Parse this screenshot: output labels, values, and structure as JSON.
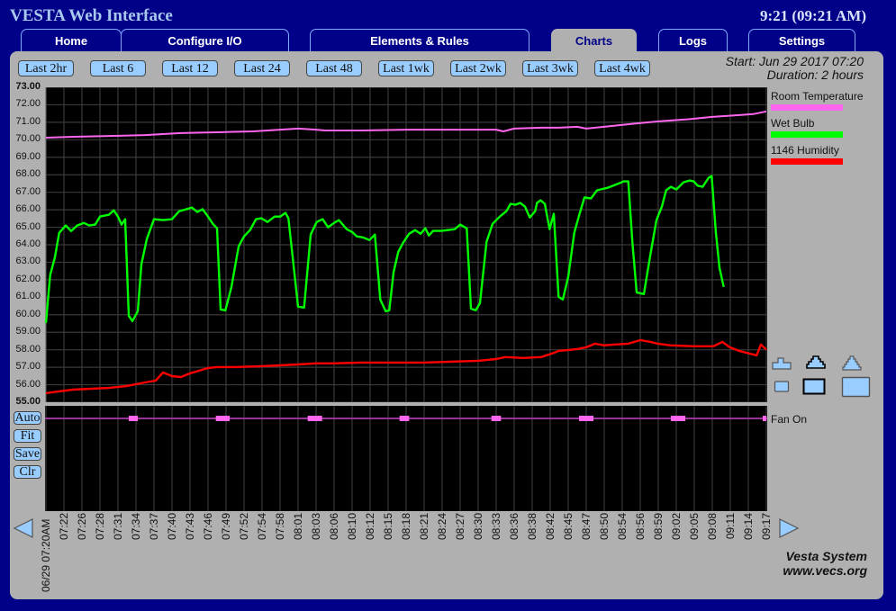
{
  "header": {
    "title": "VESTA Web Interface",
    "clock": "9:21 (09:21 AM)"
  },
  "tabs": [
    {
      "label": "Home",
      "active": false
    },
    {
      "label": "Configure I/O",
      "active": false
    },
    {
      "label": "Elements & Rules",
      "active": false
    },
    {
      "label": "Charts",
      "active": true
    },
    {
      "label": "Logs",
      "active": false
    },
    {
      "label": "Settings",
      "active": false
    }
  ],
  "range_buttons": [
    "Last 2hr",
    "Last 6",
    "Last 12",
    "Last 24",
    "Last 48",
    "Last 1wk",
    "Last 2wk",
    "Last 3wk",
    "Last 4wk"
  ],
  "info": {
    "start": "Start: Jun 29 2017 07:20",
    "duration": "Duration: 2 hours"
  },
  "side_buttons": [
    "Auto",
    "Fit",
    "Save",
    "Clr"
  ],
  "footer": {
    "line1": "Vesta System",
    "line2": "www.vecs.org"
  },
  "nav": {
    "prev": "previous-period",
    "next": "next-period"
  },
  "zoom_controls": [
    "zoom-in-small",
    "zoom-in-medium-selected",
    "zoom-in-large",
    "size-small",
    "size-medium-selected",
    "size-large"
  ],
  "colors": {
    "background": "#000088",
    "panel": "#b0b0b0",
    "button": "#99ccff",
    "room_temp": "#ff66ee",
    "wet_bulb": "#00ff00",
    "humidity": "#ff0000",
    "fan_on": "#ff66ee",
    "fan_line": "#993399"
  },
  "chart_data": [
    {
      "type": "line",
      "title": "",
      "ylim": [
        55,
        73
      ],
      "yticks": [
        "73.00",
        "72.00",
        "71.00",
        "70.00",
        "69.00",
        "68.00",
        "67.00",
        "66.00",
        "65.00",
        "64.00",
        "63.00",
        "62.00",
        "61.00",
        "60.00",
        "59.00",
        "58.00",
        "57.00",
        "56.00",
        "55.00"
      ],
      "xlim_minutes": [
        0,
        120
      ],
      "xticks": [
        "06/29 07:20AM",
        "07:22",
        "07:26",
        "07:28",
        "07:31",
        "07:34",
        "07:37",
        "07:40",
        "07:43",
        "07:46",
        "07:49",
        "07:52",
        "07:54",
        "07:58",
        "08:01",
        "08:03",
        "08:06",
        "08:10",
        "08:12",
        "08:15",
        "08:18",
        "08:21",
        "08:24",
        "08:27",
        "08:30",
        "08:33",
        "08:36",
        "08:38",
        "08:42",
        "08:45",
        "08:47",
        "08:50",
        "08:54",
        "08:56",
        "08:59",
        "09:02",
        "09:05",
        "09:08",
        "09:11",
        "09:14",
        "09:17"
      ],
      "grid": true,
      "legend_position": "right",
      "series": [
        {
          "name": "Room Temperature",
          "color": "#ff66ee",
          "x": [
            0,
            4.5,
            10.5,
            16.5,
            22.5,
            28.5,
            34.5,
            39,
            42,
            45,
            46.5,
            52.5,
            60,
            67.5,
            75,
            76.2,
            78,
            82.5,
            85.5,
            88.5,
            90,
            93,
            97.5,
            102,
            106.5,
            111,
            115.5,
            117.8,
            119.3,
            120
          ],
          "y": [
            70.12,
            70.17,
            70.22,
            70.27,
            70.38,
            70.43,
            70.48,
            70.58,
            70.64,
            70.58,
            70.53,
            70.53,
            70.58,
            70.58,
            70.58,
            70.48,
            70.64,
            70.69,
            70.69,
            70.74,
            70.64,
            70.74,
            70.9,
            71.05,
            71.16,
            71.31,
            71.41,
            71.47,
            71.57,
            71.62
          ]
        },
        {
          "name": "Wet Bulb",
          "color": "#00ff00",
          "x": [
            0,
            0.7,
            1.5,
            2.2,
            3.3,
            4.2,
            5.2,
            6.3,
            7.2,
            8.2,
            9,
            10.5,
            11.3,
            12,
            12.6,
            13.2,
            13.8,
            14.4,
            15.3,
            15.9,
            16.8,
            18,
            19.5,
            21,
            22.2,
            23.4,
            24.3,
            25.2,
            26.1,
            27,
            27.8,
            28.5,
            29.1,
            29.9,
            30.9,
            32.1,
            33,
            34,
            35,
            35.9,
            36.9,
            38.1,
            39,
            39.9,
            40.4,
            42,
            43,
            44.1,
            45.1,
            46.1,
            47,
            48,
            48.8,
            50.1,
            51,
            51.8,
            52.8,
            53.9,
            54.8,
            55.7,
            56.6,
            57.2,
            57.9,
            58.7,
            59.5,
            60.5,
            61.5,
            62.4,
            63.2,
            63.8,
            64.5,
            65.9,
            68.1,
            69,
            70.1,
            70.8,
            71.6,
            72.3,
            73.4,
            74.4,
            75.6,
            76.7,
            77.4,
            78.2,
            79,
            79.8,
            80.6,
            81.5,
            81.8,
            82.4,
            83.1,
            83.9,
            84.6,
            85.4,
            86.1,
            87,
            88,
            88.8,
            89.7,
            90.8,
            91.8,
            93.6,
            94.8,
            95.9,
            96.2,
            97,
            97.7,
            98.4,
            99.6,
            100.7,
            101.7,
            102.6,
            103.3,
            104.1,
            105,
            106.2,
            107.2,
            107.9,
            108.6,
            109.4,
            110.4,
            110.9,
            111.6,
            112.2,
            112.9
          ],
          "y": [
            59.53,
            62.26,
            63.29,
            64.68,
            65.1,
            64.78,
            65.1,
            65.25,
            65.1,
            65.15,
            65.61,
            65.72,
            65.97,
            65.61,
            65.15,
            65.46,
            59.94,
            59.64,
            60.2,
            62.88,
            64.32,
            65.46,
            65.41,
            65.46,
            65.92,
            66.03,
            66.13,
            65.87,
            66.03,
            65.61,
            65.2,
            64.94,
            60.3,
            60.25,
            61.59,
            63.91,
            64.48,
            64.84,
            65.46,
            65.51,
            65.3,
            65.61,
            65.61,
            65.82,
            65.51,
            60.46,
            60.41,
            64.58,
            65.3,
            65.46,
            65.0,
            65.25,
            65.41,
            64.89,
            64.73,
            64.48,
            64.42,
            64.27,
            64.58,
            60.87,
            60.2,
            60.25,
            62.42,
            63.6,
            64.12,
            64.63,
            64.84,
            64.63,
            64.94,
            64.53,
            64.79,
            64.79,
            64.89,
            65.15,
            64.94,
            60.35,
            60.25,
            60.66,
            64.17,
            65.2,
            65.61,
            65.92,
            66.34,
            66.29,
            66.39,
            66.18,
            65.56,
            65.92,
            66.39,
            66.54,
            66.34,
            64.89,
            65.77,
            61.02,
            60.87,
            62.16,
            64.68,
            65.66,
            66.7,
            66.65,
            67.11,
            67.26,
            67.42,
            67.57,
            67.62,
            67.62,
            64.12,
            61.28,
            61.18,
            63.45,
            65.41,
            66.18,
            67.11,
            67.31,
            67.16,
            67.57,
            67.67,
            67.62,
            67.37,
            67.31,
            67.83,
            67.93,
            64.68,
            62.68,
            61.59
          ]
        },
        {
          "name": "1146 Humidity",
          "color": "#ff0000",
          "x": [
            0,
            2.2,
            4.5,
            7.5,
            10.5,
            13.5,
            16.5,
            18.3,
            19.5,
            21,
            22.5,
            24,
            25.5,
            27,
            28.5,
            31.5,
            36,
            39,
            42,
            45,
            48,
            52.5,
            57,
            63,
            67.5,
            72,
            75,
            76.5,
            79.5,
            82.5,
            84.3,
            85.5,
            87,
            88.5,
            90,
            91.5,
            93,
            94.8,
            97,
            99,
            100.7,
            101.9,
            104.1,
            107.9,
            111.2,
            112.7,
            113.9,
            115.4,
            118.4,
            119.1,
            120
          ],
          "y": [
            55.52,
            55.62,
            55.72,
            55.77,
            55.82,
            55.93,
            56.13,
            56.24,
            56.7,
            56.49,
            56.44,
            56.65,
            56.8,
            56.96,
            57.01,
            57.01,
            57.06,
            57.11,
            57.16,
            57.22,
            57.22,
            57.27,
            57.27,
            57.27,
            57.32,
            57.37,
            57.47,
            57.58,
            57.53,
            57.58,
            57.78,
            57.94,
            57.99,
            58.04,
            58.14,
            58.35,
            58.25,
            58.3,
            58.35,
            58.55,
            58.45,
            58.35,
            58.25,
            58.2,
            58.2,
            58.45,
            58.14,
            57.94,
            57.68,
            58.3,
            58.0
          ]
        }
      ]
    },
    {
      "type": "line",
      "title": "Fan On",
      "series": [
        {
          "name": "Fan On",
          "color": "#ff66ee",
          "on_intervals_minutes": [
            [
              13.8,
              15.3
            ],
            [
              28.3,
              30.6
            ],
            [
              43.6,
              46
            ],
            [
              58.9,
              60.5
            ],
            [
              74.2,
              75.8
            ],
            [
              88.8,
              91.2
            ],
            [
              104.1,
              106.5
            ],
            [
              119.4,
              120
            ]
          ]
        }
      ]
    }
  ]
}
